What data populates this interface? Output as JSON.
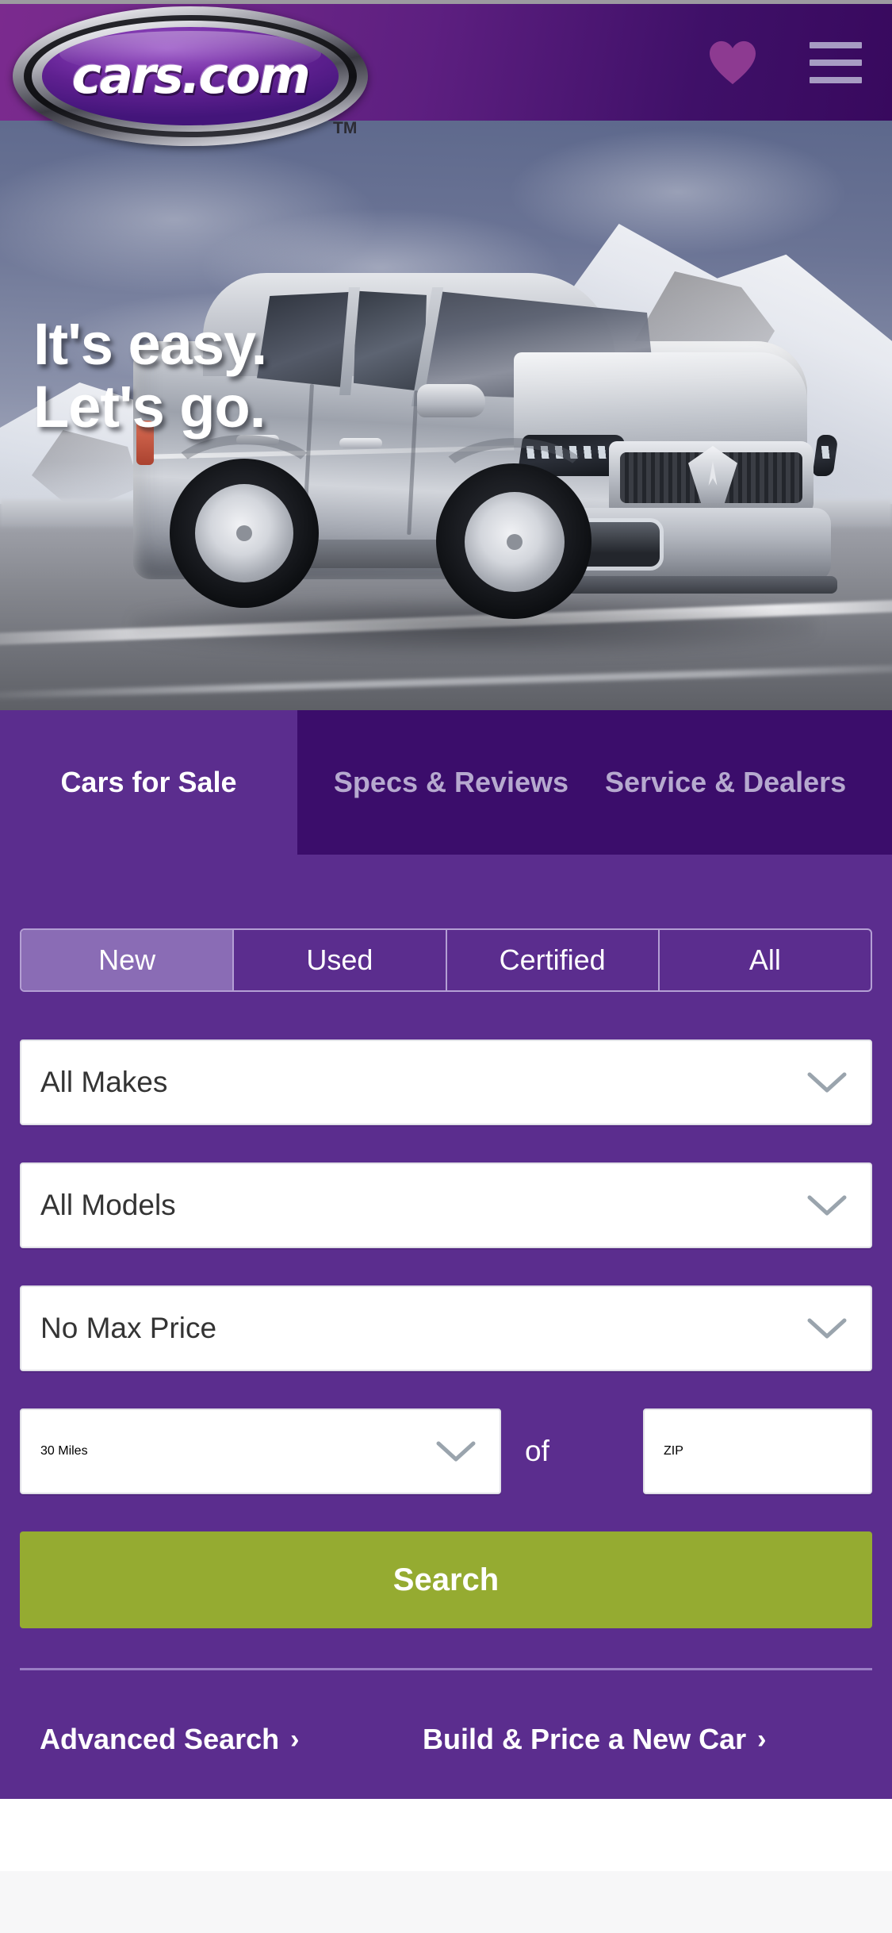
{
  "brand": {
    "logo_text": "cars.com",
    "trademark": "TM",
    "accent_purple": "#5b2d8e",
    "dark_purple": "#3b0d6b",
    "green": "#95ab31",
    "lavender": "#b49fd4"
  },
  "header": {
    "favorites_icon": "heart-icon",
    "menu_icon": "hamburger-menu-icon"
  },
  "hero": {
    "headline_line1": "It's easy.",
    "headline_line2": "Let's go.",
    "image_alt": "silver Acura RDX SUV driving on mountain road"
  },
  "tabs": [
    {
      "label": "Cars for Sale",
      "active": true
    },
    {
      "label": "Specs & Reviews",
      "active": false
    },
    {
      "label": "Service & Dealers",
      "active": false
    }
  ],
  "search": {
    "condition_options": [
      {
        "label": "New",
        "selected": true
      },
      {
        "label": "Used",
        "selected": false
      },
      {
        "label": "Certified",
        "selected": false
      },
      {
        "label": "All",
        "selected": false
      }
    ],
    "make": {
      "value": "All Makes",
      "icon": "chevron-down-icon"
    },
    "model": {
      "value": "All Models",
      "icon": "chevron-down-icon"
    },
    "price": {
      "value": "No Max Price",
      "icon": "chevron-down-icon"
    },
    "distance": {
      "value": "30 Miles",
      "icon": "chevron-down-icon"
    },
    "of_label": "of",
    "zip": {
      "value": "",
      "placeholder": "ZIP"
    },
    "submit_label": "Search"
  },
  "links": [
    {
      "label": "Advanced Search",
      "caret": "›"
    },
    {
      "label": "Build & Price a New Car",
      "caret": "›"
    }
  ]
}
